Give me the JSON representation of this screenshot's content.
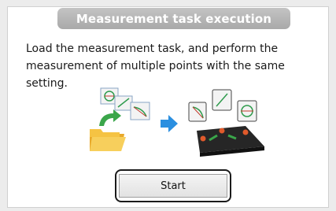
{
  "header": {
    "title": "Measurement task execution"
  },
  "description": "Load the measurement task, and perform the measurement of multiple points with the same setting.",
  "illustration": {
    "left_icon": "folder-with-task-cards-icon",
    "arrow_icon": "arrow-right-icon",
    "right_icon": "measurement-stage-icon"
  },
  "actions": {
    "start_label": "Start"
  },
  "colors": {
    "title_bar": "#b3b3b3",
    "arrow": "#2b8fe0",
    "folder": "#f5c343",
    "green_arrow": "#3aa64a"
  }
}
